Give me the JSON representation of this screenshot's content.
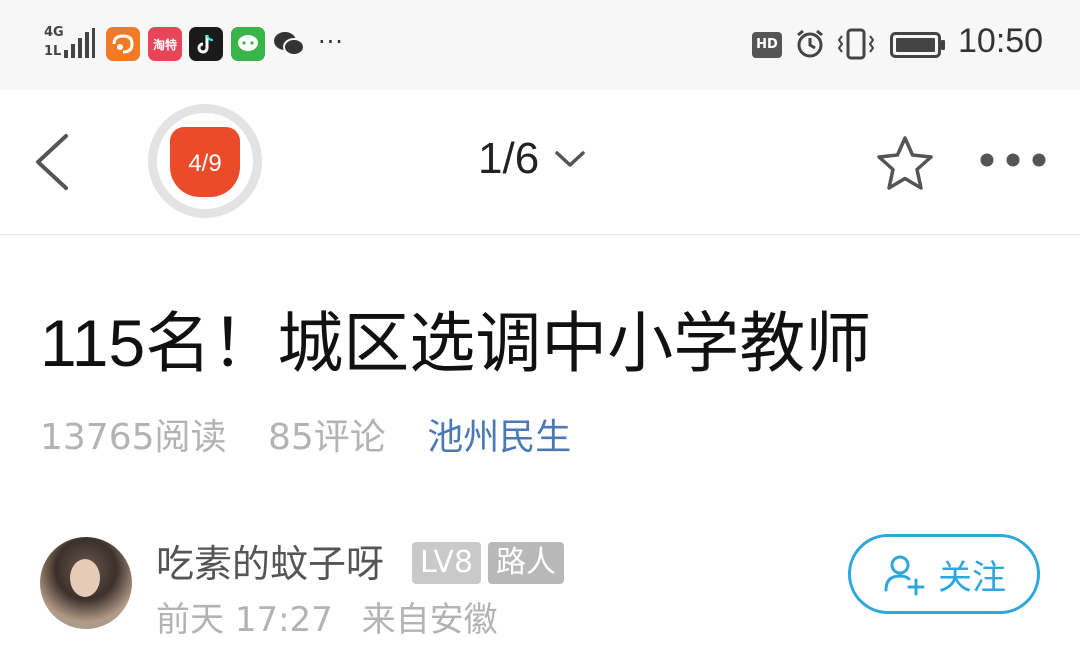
{
  "status_bar": {
    "network_top": "4G",
    "network_bottom": "1L",
    "time": "10:50",
    "hd_label": "HD",
    "apps": [
      {
        "name": "uc-browser",
        "label": "",
        "color": "#f07a26"
      },
      {
        "name": "taote",
        "label": "淘特",
        "color": "#e8455b"
      },
      {
        "name": "tiktok",
        "label": "",
        "color": "#1a1a1a"
      },
      {
        "name": "wechat-green",
        "label": "",
        "color": "#39b54a"
      }
    ],
    "more": "···"
  },
  "nav": {
    "progress_badge": "4/9",
    "page_indicator": "1/6"
  },
  "article": {
    "title": "115名！城区选调中小学教师",
    "reads": "13765阅读",
    "comments": "85评论",
    "channel": "池州民生"
  },
  "author": {
    "name": "吃素的蚊子呀",
    "level_tag": "LV8",
    "role_tag": "路人",
    "time": "前天 17:27",
    "source": "来自安徽",
    "follow_label": "关注"
  },
  "colors": {
    "accent_red": "#ec4b2a",
    "link_blue": "#4a79b6",
    "follow_blue": "#2da7dc"
  }
}
